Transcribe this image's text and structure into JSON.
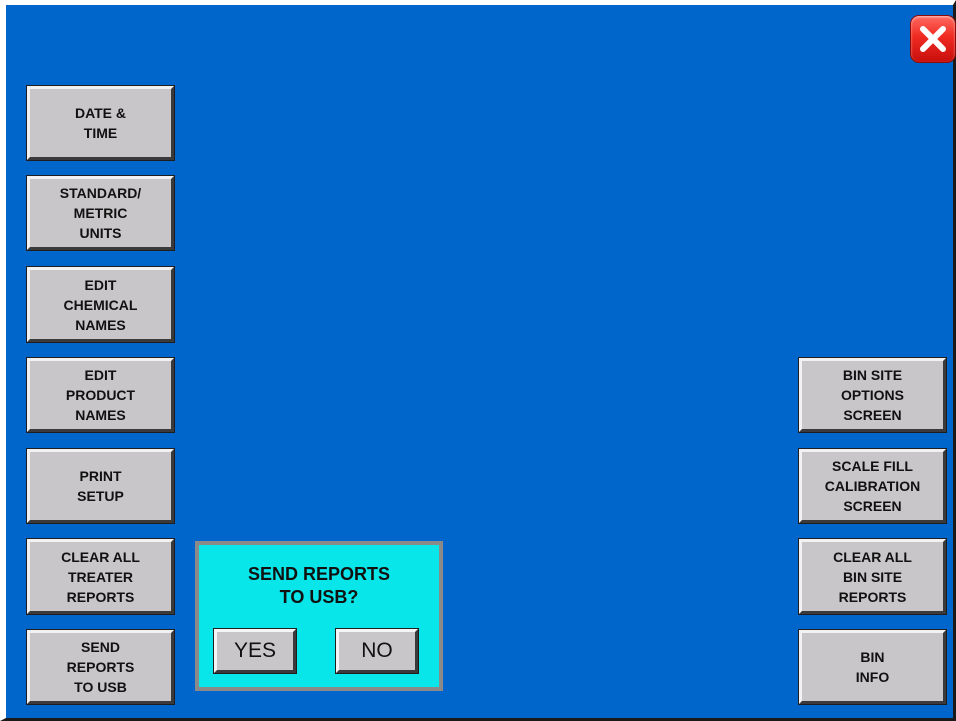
{
  "colors": {
    "background": "#0066cc",
    "button_face": "#c9c6c9",
    "dialog_background": "#08e6ea",
    "close_button": "#ef2a22"
  },
  "close_button": {
    "icon": "close-icon"
  },
  "left_menu": {
    "date_time": "DATE &\nTIME",
    "units": "STANDARD/\nMETRIC\nUNITS",
    "chemical_names": "EDIT\nCHEMICAL\nNAMES",
    "product_names": "EDIT\nPRODUCT\nNAMES",
    "print_setup": "PRINT\nSETUP",
    "clear_treater": "CLEAR ALL\nTREATER\nREPORTS",
    "send_reports": "SEND\nREPORTS\nTO USB"
  },
  "right_menu": {
    "bin_site_options": "BIN SITE\nOPTIONS\nSCREEN",
    "scale_fill": "SCALE FILL\nCALIBRATION\nSCREEN",
    "clear_bin_site": "CLEAR ALL\nBIN SITE\nREPORTS",
    "bin_info": "BIN\nINFO"
  },
  "dialog": {
    "message": "SEND REPORTS\nTO USB?",
    "yes_label": "YES",
    "no_label": "NO"
  }
}
